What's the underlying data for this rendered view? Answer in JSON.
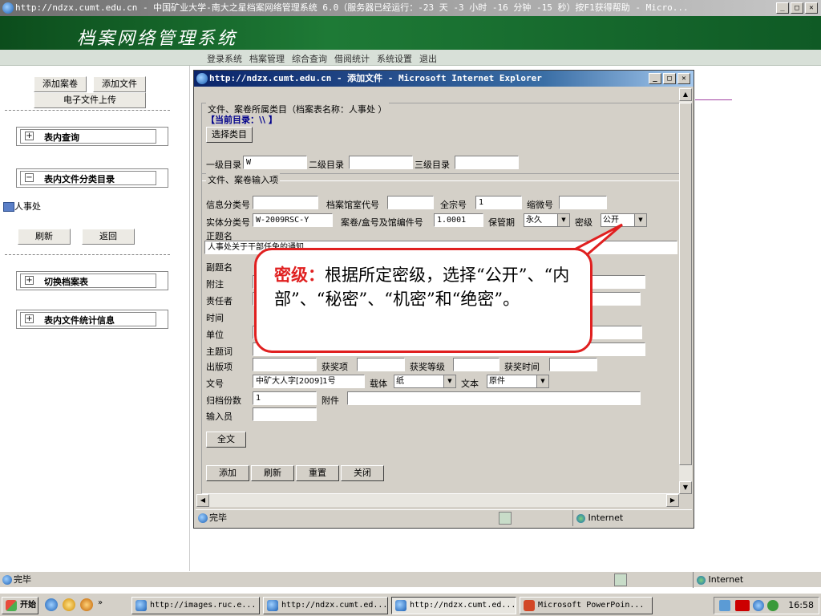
{
  "browser": {
    "title": "http://ndzx.cumt.edu.cn - 中国矿业大学-南大之星档案网络管理系统 6.0（服务器已经运行：-23 天 -3 小时 -16 分钟 -15 秒）按F1获得帮助 - Micro..."
  },
  "header": {
    "logo": "档案网络管理系统"
  },
  "menu": {
    "items": [
      "登录系统",
      "档案管理",
      "综合查询",
      "借阅统计",
      "系统设置",
      "退出"
    ]
  },
  "sidebar": {
    "add_volume": "添加案卷",
    "add_file": "添加文件",
    "upload": "电子文件上传",
    "query": "表内查询",
    "category": "表内文件分类目录",
    "tree_item": "人事处",
    "refresh": "刷新",
    "back": "返回",
    "switch": "切换档案表",
    "stats": "表内文件统计信息"
  },
  "popup": {
    "title": "http://ndzx.cumt.edu.cn - 添加文件 - Microsoft Internet Explorer",
    "sec1_legend": "文件、案卷所属类目（档案表名称：人事处 ）",
    "current_dir": "【当前目录：\\\\ 】",
    "select_cat": "选择类目",
    "level1": "一级目录",
    "level1_value": "W",
    "level2": "二级目录",
    "level3": "三级目录",
    "sec2_legend": "文件、案卷输入项",
    "info_class": "信息分类号",
    "room_code": "档案馆室代号",
    "fonds": "全宗号",
    "fonds_value": "1",
    "micro": "缩微号",
    "entity_class": "实体分类号",
    "entity_value": "W-2009RSC-Y",
    "box_no": "案卷/盒号及馆编件号",
    "box_value": "1.0001",
    "retention": "保管期",
    "retention_value": "永久",
    "secret": "密级",
    "secret_value": "公开",
    "main_title": "正题名",
    "main_title_value": "人事处关于干部任免的通知",
    "sub_title": "副题名",
    "note": "附注",
    "resp": "责任者",
    "time": "时间",
    "unit": "单位",
    "subject": "主题词",
    "pub": "出版项",
    "award": "获奖项",
    "award_level": "获奖等级",
    "award_time": "获奖时间",
    "doc_no": "文号",
    "doc_no_value": "中矿大人字[2009]1号",
    "carrier": "载体",
    "carrier_value": "纸",
    "text": "文本",
    "text_value": "原件",
    "copies": "归档份数",
    "copies_value": "1",
    "attach": "附件",
    "inputter": "输入员",
    "fulltext": "全文",
    "add": "添加",
    "refresh": "刷新",
    "reset": "重置",
    "close": "关闭",
    "status": "完毕",
    "zone": "Internet"
  },
  "callout": {
    "key": "密级：",
    "text": "根据所定密级，选择“公开”、“内部”、“秘密”、“机密”和“绝密”。"
  },
  "status": {
    "text": "完毕",
    "zone": "Internet"
  },
  "taskbar": {
    "start": "开始",
    "items": [
      "http://images.ruc.e...",
      "http://ndzx.cumt.ed...",
      "http://ndzx.cumt.ed...",
      "Microsoft PowerPoin..."
    ],
    "clock": "16:58"
  },
  "colors": {
    "header_green": "#1e7a36",
    "callout_red": "#e02020",
    "title_blue": "#0a246a"
  }
}
